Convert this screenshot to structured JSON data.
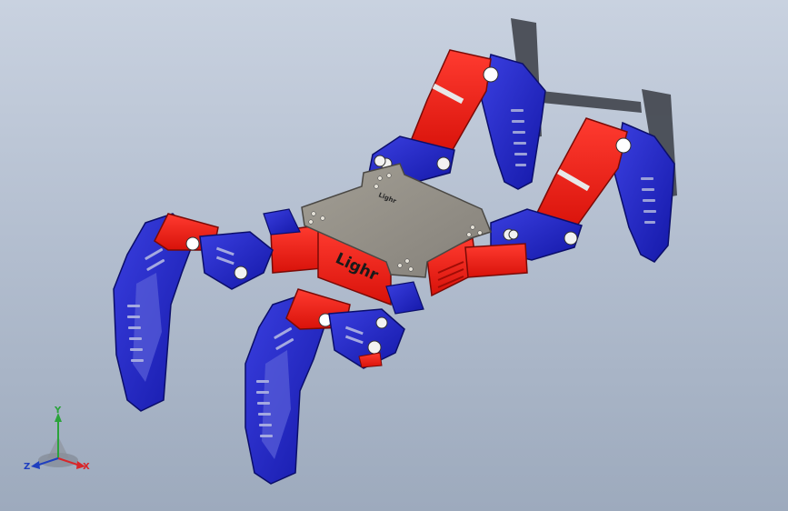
{
  "model": {
    "brand_text": "Lighr",
    "plate_marking": "Lighr"
  },
  "triad": {
    "x_label": "X",
    "y_label": "Y",
    "z_label": "Z",
    "x_color": "#d8262a",
    "y_color": "#2aa33a",
    "z_color": "#1f3fbf"
  },
  "colors": {
    "frame_blue": "#1f23c9",
    "servo_red": "#f01a12",
    "plate_gray": "#8e8a80",
    "background_top": "#c9d2e0",
    "background_bottom": "#9daabd"
  }
}
